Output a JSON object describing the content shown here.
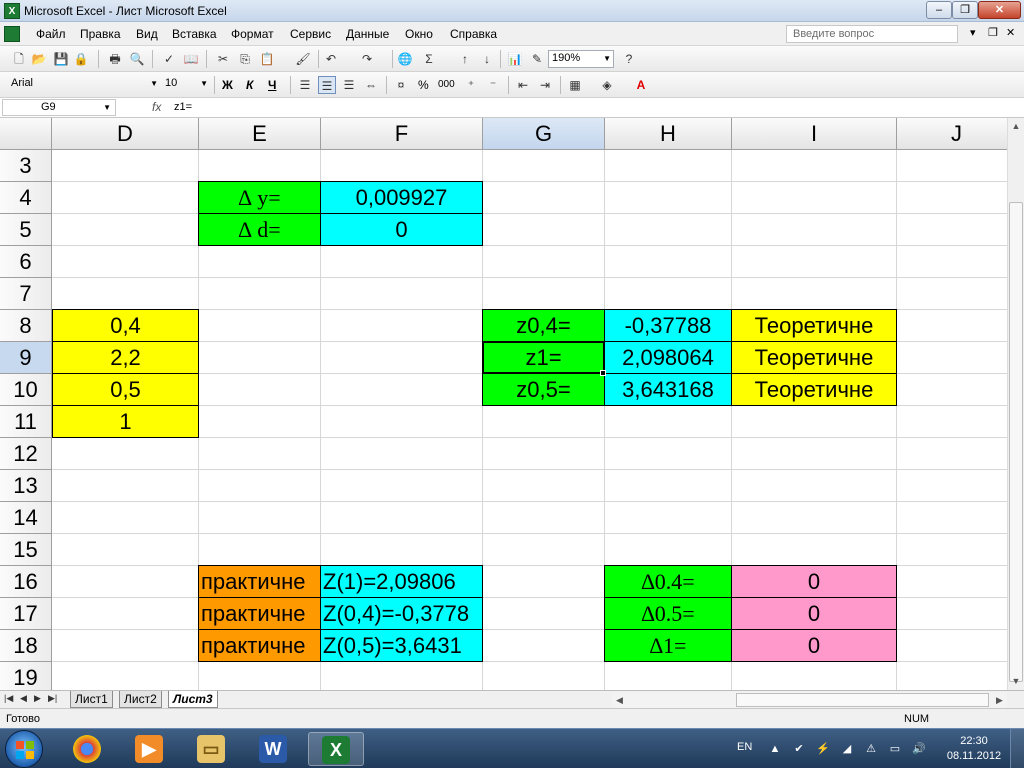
{
  "window": {
    "title": "Microsoft Excel - Лист Microsoft Excel",
    "app_icon": "excel-icon"
  },
  "menu": [
    "Файл",
    "Правка",
    "Вид",
    "Вставка",
    "Формат",
    "Сервис",
    "Данные",
    "Окно",
    "Справка"
  ],
  "help_placeholder": "Введите вопрос",
  "toolbar_std": {
    "zoom": "190%"
  },
  "toolbar_fmt": {
    "font": "Arial",
    "size": "10",
    "bold": "Ж",
    "italic": "К",
    "underline": "Ч",
    "percent": "%",
    "thousands": "000"
  },
  "formula_bar": {
    "name_box": "G9",
    "fx": "fx",
    "formula": "z1="
  },
  "grid": {
    "columns": [
      "D",
      "E",
      "F",
      "G",
      "H",
      "I",
      "J"
    ],
    "selected_column": "G",
    "rows": [
      "3",
      "4",
      "5",
      "6",
      "7",
      "8",
      "9",
      "10",
      "11",
      "12",
      "13",
      "14",
      "15",
      "16",
      "17",
      "18",
      "19"
    ],
    "selected_row": "9",
    "cells": {
      "E4": "∆ y=",
      "F4": "0,009927",
      "E5": "∆ d=",
      "F5": "0",
      "D8": "0,4",
      "G8": "z0,4=",
      "H8": "-0,37788",
      "I8": "Теоретичне",
      "D9": "2,2",
      "G9": "z1=",
      "H9": "2,098064",
      "I9": "Теоретичне",
      "D10": "0,5",
      "G10": "z0,5=",
      "H10": "3,643168",
      "I10": "Теоретичне",
      "D11": "1",
      "E16": "практичне",
      "F16": "Z(1)=2,09806",
      "H16": "∆0.4=",
      "I16": "0",
      "E17": "практичне",
      "F17": "Z(0,4)=-0,3778",
      "H17": "∆0.5=",
      "I17": "0",
      "E18": "практичне",
      "F18": "Z(0,5)=3,6431",
      "H18": "∆1=",
      "I18": "0"
    }
  },
  "sheet_tabs": [
    "Лист1",
    "Лист2",
    "Лист3"
  ],
  "active_sheet": "Лист3",
  "status": {
    "left": "Готово",
    "right": "NUM"
  },
  "taskbar": {
    "apps": [
      "chrome-icon",
      "media-player-icon",
      "folder-icon",
      "word-icon",
      "excel-icon"
    ],
    "lang": "EN",
    "time": "22:30",
    "date": "08.11.2012"
  },
  "colors": {
    "yellow": "#ffff00",
    "green": "#00ff00",
    "cyan": "#00ffff",
    "orange": "#ff9900",
    "pink": "#ff99cc",
    "selection": "#c7d9ef"
  }
}
